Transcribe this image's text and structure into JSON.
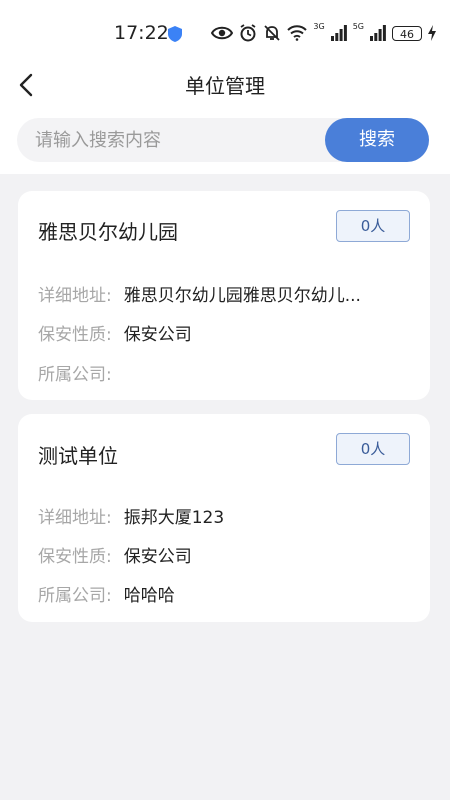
{
  "status": {
    "time": "17:22",
    "net1": "3G",
    "net2": "5G",
    "battery": "46"
  },
  "header": {
    "title": "单位管理"
  },
  "search": {
    "placeholder": "请输入搜索内容",
    "button": "搜索"
  },
  "labels": {
    "address": "详细地址:",
    "security": "保安性质:",
    "company": "所属公司:"
  },
  "units": [
    {
      "name": "雅思贝尔幼儿园",
      "count": "0人",
      "address": "雅思贝尔幼儿园雅思贝尔幼儿...",
      "security": "保安公司",
      "company": ""
    },
    {
      "name": "测试单位",
      "count": "0人",
      "address": "振邦大厦123",
      "security": "保安公司",
      "company": "哈哈哈"
    }
  ],
  "colors": {
    "accent": "#4a7fd9",
    "badge_border": "#8ea9d6",
    "badge_bg": "#eef3fb"
  }
}
